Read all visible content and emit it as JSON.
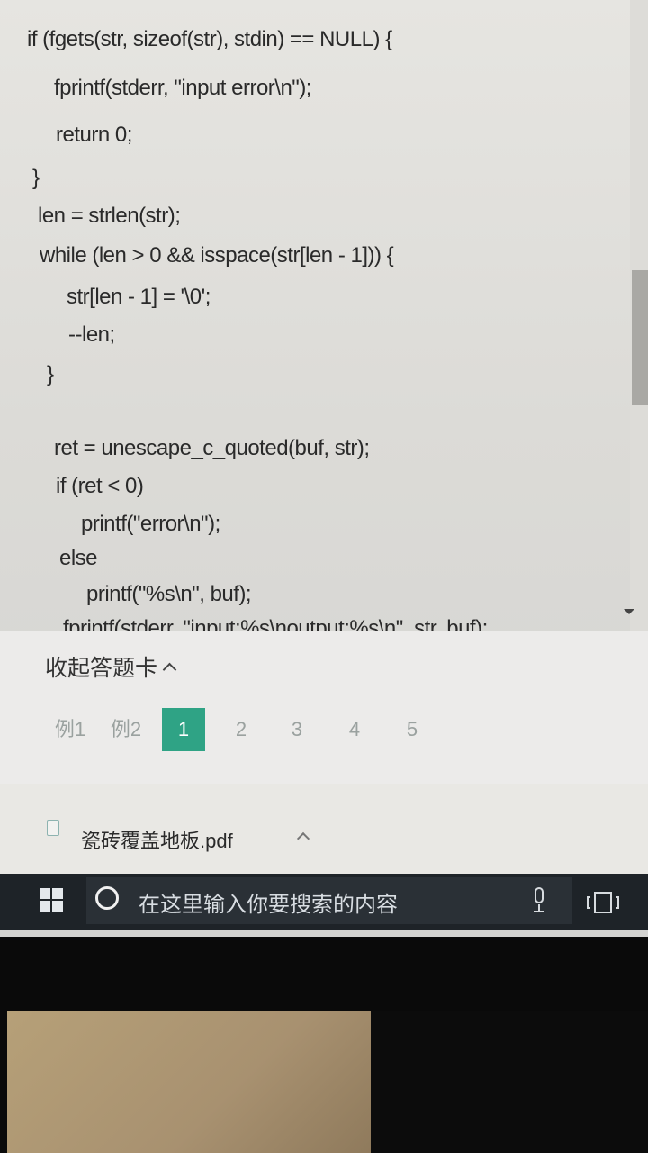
{
  "code_lines": [
    "if (fgets(str, sizeof(str), stdin) == NULL) {",
    "fprintf(stderr, \"input error\\n\");",
    "return 0;",
    "}",
    "len = strlen(str);",
    "while (len > 0 && isspace(str[len - 1])) {",
    "str[len - 1] = '\\0';",
    "--len;",
    "}",
    "ret = unescape_c_quoted(buf, str);",
    "if (ret < 0)",
    "printf(\"error\\n\");",
    "else",
    "printf(\"%s\\n\", buf);",
    "fprintf(stderr, \"input:%s\\noutput:%s\\n\", str, buf);"
  ],
  "answer_card": {
    "collapse_label": "收起答题卡",
    "items": [
      "例1",
      "例2",
      "1",
      "2",
      "3",
      "4",
      "5"
    ],
    "active_index": 2,
    "accent_color": "#2fa385"
  },
  "download": {
    "file_name": "瓷砖覆盖地板.pdf"
  },
  "taskbar": {
    "search_placeholder": "在这里输入你要搜索的内容",
    "icons": [
      "windows-start-icon",
      "cortana-icon",
      "microphone-icon",
      "task-view-icon"
    ]
  }
}
